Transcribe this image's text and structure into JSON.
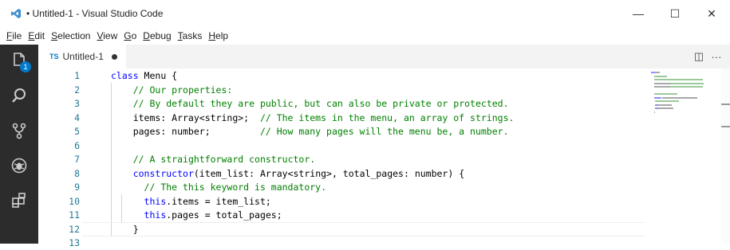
{
  "window": {
    "title": "• Untitled-1 - Visual Studio Code",
    "minimize_label": "—",
    "maximize_label": "☐",
    "close_label": "✕"
  },
  "menu": {
    "items": [
      {
        "mnemonic": "F",
        "rest": "ile"
      },
      {
        "mnemonic": "E",
        "rest": "dit"
      },
      {
        "mnemonic": "S",
        "rest": "election"
      },
      {
        "mnemonic": "V",
        "rest": "iew"
      },
      {
        "mnemonic": "G",
        "rest": "o"
      },
      {
        "mnemonic": "D",
        "rest": "ebug"
      },
      {
        "mnemonic": "T",
        "rest": "asks"
      },
      {
        "mnemonic": "H",
        "rest": "elp"
      }
    ]
  },
  "activity": {
    "explorer_badge": "1",
    "icons": [
      "explorer-icon",
      "search-icon",
      "source-control-icon",
      "debug-icon",
      "extensions-icon"
    ]
  },
  "tab": {
    "icon_text": "TS",
    "label": "Untitled-1",
    "split_label": "◫",
    "more_label": "···"
  },
  "editor": {
    "lines": [
      {
        "no": "1",
        "tokens": [
          {
            "t": "class",
            "c": "kw"
          },
          {
            "t": " Menu {",
            "c": ""
          }
        ]
      },
      {
        "no": "2",
        "tokens": [
          {
            "t": "    ",
            "c": ""
          },
          {
            "t": "// Our properties:",
            "c": "cm"
          }
        ]
      },
      {
        "no": "3",
        "tokens": [
          {
            "t": "    ",
            "c": ""
          },
          {
            "t": "// By default they are public, but can also be private or protected.",
            "c": "cm"
          }
        ]
      },
      {
        "no": "4",
        "tokens": [
          {
            "t": "    items: Array<string>;  ",
            "c": ""
          },
          {
            "t": "// The items in the menu, an array of strings.",
            "c": "cm"
          }
        ]
      },
      {
        "no": "5",
        "tokens": [
          {
            "t": "    pages: number;         ",
            "c": ""
          },
          {
            "t": "// How many pages will the menu be, a number.",
            "c": "cm"
          }
        ]
      },
      {
        "no": "6",
        "tokens": []
      },
      {
        "no": "7",
        "tokens": [
          {
            "t": "    ",
            "c": ""
          },
          {
            "t": "// A straightforward constructor.",
            "c": "cm"
          }
        ]
      },
      {
        "no": "8",
        "tokens": [
          {
            "t": "    ",
            "c": ""
          },
          {
            "t": "constructor",
            "c": "kw"
          },
          {
            "t": "(item_list: Array<string>, total_pages: number) {",
            "c": ""
          }
        ]
      },
      {
        "no": "9",
        "tokens": [
          {
            "t": "      ",
            "c": ""
          },
          {
            "t": "// The this keyword is mandatory.",
            "c": "cm"
          }
        ]
      },
      {
        "no": "10",
        "tokens": [
          {
            "t": "      ",
            "c": ""
          },
          {
            "t": "this",
            "c": "kw"
          },
          {
            "t": ".items = item_list;",
            "c": ""
          }
        ]
      },
      {
        "no": "11",
        "tokens": [
          {
            "t": "      ",
            "c": ""
          },
          {
            "t": "this",
            "c": "kw"
          },
          {
            "t": ".pages = total_pages;",
            "c": ""
          }
        ]
      },
      {
        "no": "12",
        "tokens": [
          {
            "t": "    }",
            "c": ""
          }
        ]
      },
      {
        "no": "13",
        "tokens": []
      }
    ],
    "current_line": 12
  },
  "colors": {
    "keyword": "#0000ff",
    "comment": "#008000",
    "line_number": "#237893",
    "activity_bar": "#2c2c2c",
    "accent": "#007acc"
  }
}
